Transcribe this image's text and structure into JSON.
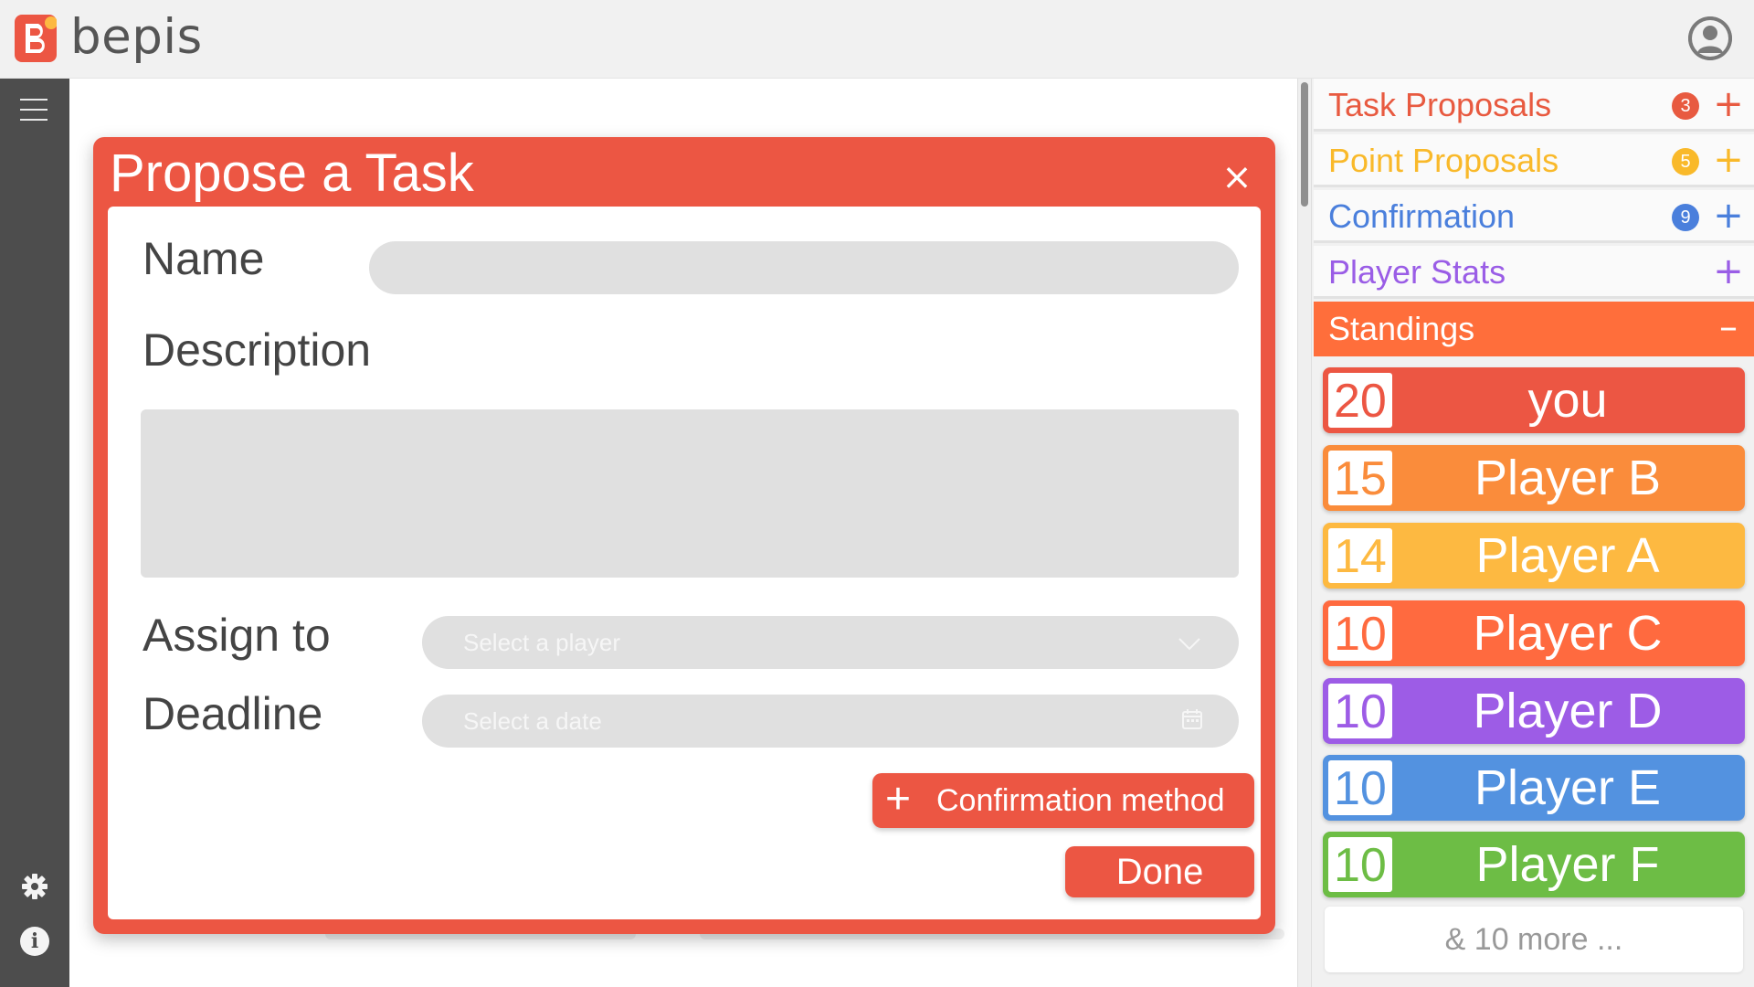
{
  "app": {
    "brand": "bepis"
  },
  "modal": {
    "title": "Propose a Task",
    "close_label": "×",
    "name_label": "Name",
    "name_value": "",
    "description_label": "Description",
    "description_value": "",
    "assign_label": "Assign to",
    "assign_placeholder": "Select a player",
    "deadline_label": "Deadline",
    "deadline_placeholder": "Select a date",
    "confirm_button": "Confirmation method",
    "done_button": "Done"
  },
  "panel": {
    "sections": [
      {
        "title": "Task Proposals",
        "badge": "3",
        "color": "#e85a40",
        "toggle": "+"
      },
      {
        "title": "Point Proposals",
        "badge": "5",
        "color": "#f9b92a",
        "toggle": "+"
      },
      {
        "title": "Confirmation",
        "badge": "9",
        "color": "#4a7fdc",
        "toggle": "+"
      },
      {
        "title": "Player Stats",
        "badge": "",
        "color": "#9a5de6",
        "toggle": "+"
      },
      {
        "title": "Standings",
        "badge": "",
        "color": "#ffffff",
        "toggle": "–"
      }
    ],
    "standings": [
      {
        "score": "20",
        "name": "you",
        "color": "#ec5643"
      },
      {
        "score": "15",
        "name": "Player B",
        "color": "#fa8c3b"
      },
      {
        "score": "14",
        "name": "Player A",
        "color": "#fdb941"
      },
      {
        "score": "10",
        "name": "Player C",
        "color": "#ff6a3f"
      },
      {
        "score": "10",
        "name": "Player D",
        "color": "#9d5ce6"
      },
      {
        "score": "10",
        "name": "Player E",
        "color": "#5392e0"
      },
      {
        "score": "10",
        "name": "Player F",
        "color": "#6dbd45"
      }
    ],
    "more_label": "& 10 more ..."
  }
}
